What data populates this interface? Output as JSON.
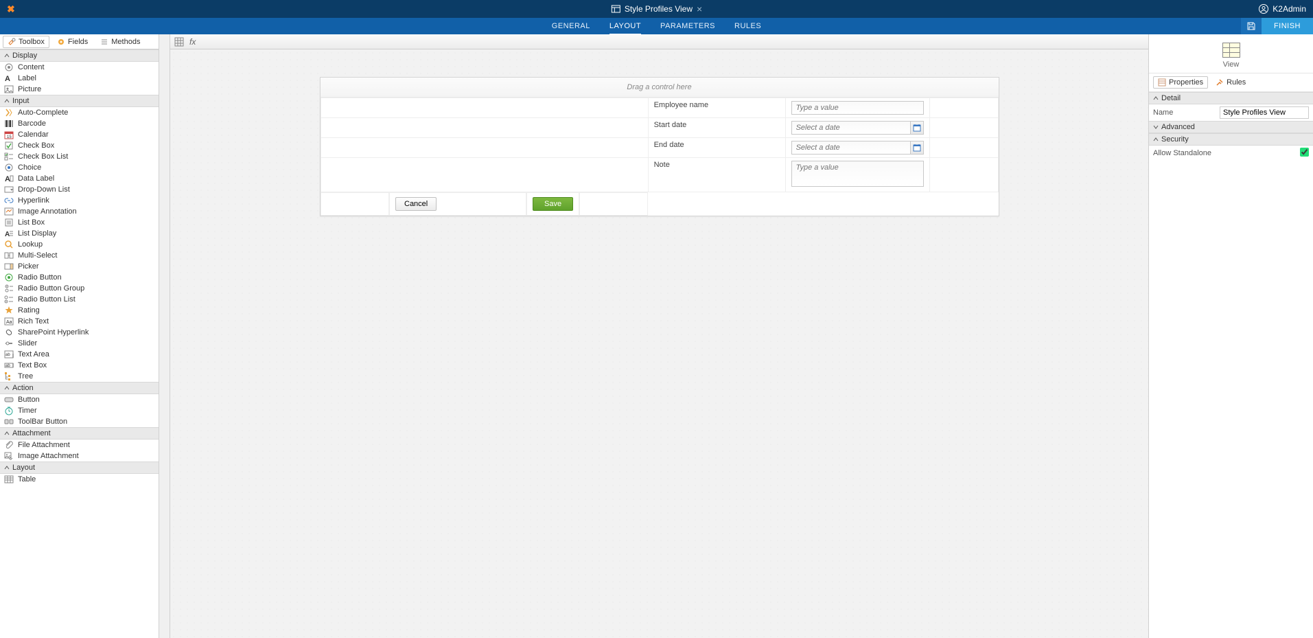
{
  "titlebar": {
    "doc_title": "Style Profiles View",
    "user": "K2Admin"
  },
  "ribbon": {
    "tabs": [
      "GENERAL",
      "LAYOUT",
      "PARAMETERS",
      "RULES"
    ],
    "active_tab": "LAYOUT",
    "finish": "FINISH"
  },
  "left_tabs": {
    "toolbox": "Toolbox",
    "fields": "Fields",
    "methods": "Methods"
  },
  "toolbox": {
    "categories": [
      {
        "name": "Display",
        "items": [
          "Content",
          "Label",
          "Picture"
        ]
      },
      {
        "name": "Input",
        "items": [
          "Auto-Complete",
          "Barcode",
          "Calendar",
          "Check Box",
          "Check Box List",
          "Choice",
          "Data Label",
          "Drop-Down List",
          "Hyperlink",
          "Image Annotation",
          "List Box",
          "List Display",
          "Lookup",
          "Multi-Select",
          "Picker",
          "Radio Button",
          "Radio Button Group",
          "Radio Button List",
          "Rating",
          "Rich Text",
          "SharePoint Hyperlink",
          "Slider",
          "Text Area",
          "Text Box",
          "Tree"
        ]
      },
      {
        "name": "Action",
        "items": [
          "Button",
          "Timer",
          "ToolBar Button"
        ]
      },
      {
        "name": "Attachment",
        "items": [
          "File Attachment",
          "Image Attachment"
        ]
      },
      {
        "name": "Layout",
        "items": [
          "Table"
        ]
      }
    ]
  },
  "formula_bar": {
    "fx": "fx"
  },
  "canvas": {
    "drop_hint": "Drag a control here",
    "fields": {
      "employee_name": {
        "label": "Employee name",
        "placeholder": "Type a value"
      },
      "start_date": {
        "label": "Start date",
        "placeholder": "Select a date"
      },
      "end_date": {
        "label": "End date",
        "placeholder": "Select a date"
      },
      "note": {
        "label": "Note",
        "placeholder": "Type a value"
      }
    },
    "buttons": {
      "cancel": "Cancel",
      "save": "Save"
    }
  },
  "right_panel": {
    "view_label": "View",
    "tabs": {
      "properties": "Properties",
      "rules": "Rules"
    },
    "sections": {
      "detail": "Detail",
      "advanced": "Advanced",
      "security": "Security"
    },
    "detail": {
      "name_label": "Name",
      "name_value": "Style Profiles View"
    },
    "security": {
      "allow_standalone_label": "Allow Standalone",
      "allow_standalone": true
    }
  }
}
